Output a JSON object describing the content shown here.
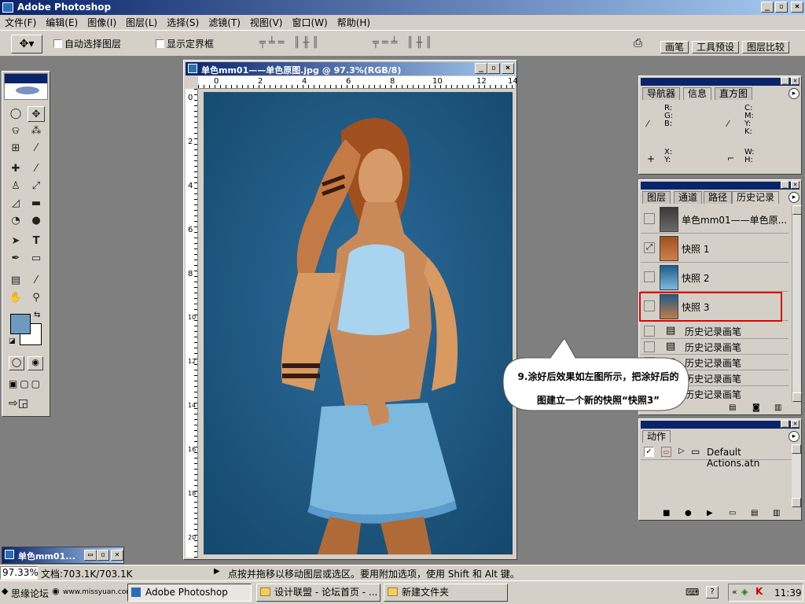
{
  "app": {
    "title": "Adobe Photoshop",
    "controls": [
      "_",
      "▫",
      "×"
    ]
  },
  "menu": [
    "文件(F)",
    "编辑(E)",
    "图像(I)",
    "图层(L)",
    "选择(S)",
    "滤镜(T)",
    "视图(V)",
    "窗口(W)",
    "帮助(H)"
  ],
  "options": {
    "auto_select": "自动选择图层",
    "show_bounds": "显示定界框",
    "tabs": [
      "画笔",
      "工具预设",
      "图层比较"
    ]
  },
  "document": {
    "title": "单色mm01——单色原图.jpg @ 97.3%(RGB/8)",
    "ruler_h": [
      "0",
      "2",
      "4",
      "6",
      "8",
      "10",
      "12",
      "14"
    ],
    "ruler_v": [
      "0",
      "2",
      "4",
      "6",
      "8",
      "10",
      "12",
      "14",
      "16",
      "18",
      "20"
    ]
  },
  "minimized_doc": {
    "title": "单色mm01..."
  },
  "navigator": {
    "tabs": [
      "导航器",
      "信息",
      "直方图"
    ],
    "rgb": "R:\nG:\nB:",
    "cmyk": "C:\nM:\nY:\nK:",
    "xy": "X:\nY:",
    "wh": "W:\nH:"
  },
  "history": {
    "tabs": [
      "图层",
      "通道",
      "路径",
      "历史记录"
    ],
    "snapshots": [
      "单色mm01——单色原...",
      "快照 1",
      "快照 2",
      "快照 3"
    ],
    "brush_steps": [
      "历史记录画笔",
      "历史记录画笔",
      "历史记录画笔",
      "历史记录画笔",
      "历史记录画笔"
    ]
  },
  "actions": {
    "tab": "动作",
    "item": "Default Actions.atn"
  },
  "callout": {
    "line1": "9.涂好后效果如左图所示，把涂好后的",
    "line2": "图建立一个新的快照“快照3”"
  },
  "status": {
    "zoom": "97.33%",
    "doc": "文档:703.1K/703.1K",
    "hint": "点按并拖移以移动图层或选区。要用附加选项，使用 Shift 和 Alt 键。"
  },
  "taskbar": {
    "items": [
      "思缘论坛",
      "www.missyuan.com",
      "Adobe Photoshop",
      "设计联盟 - 论坛首页 - ...",
      "新建文件夹"
    ],
    "time": "11:39"
  },
  "colors": {
    "accent": "#0a246a",
    "canvas_bg": "#1f5d8a",
    "highlight": "#e00000"
  }
}
